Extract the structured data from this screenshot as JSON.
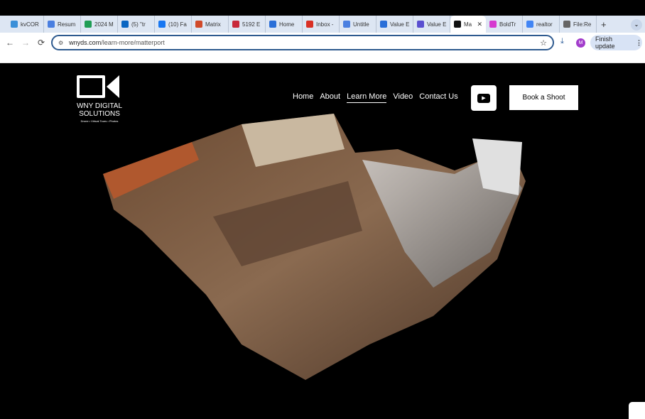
{
  "browser": {
    "tabs": [
      {
        "label": "kvCOR",
        "icon": "kvcore-icon",
        "color": "#3a8fd8"
      },
      {
        "label": "Resum",
        "icon": "docs-icon",
        "color": "#4a7fe0"
      },
      {
        "label": "2024 M",
        "icon": "sheets-icon",
        "color": "#1f9d55"
      },
      {
        "label": "(5) \"tr",
        "icon": "linkedin-icon",
        "color": "#0a66c2"
      },
      {
        "label": "(10) Fa",
        "icon": "facebook-icon",
        "color": "#1877f2"
      },
      {
        "label": "Matrix",
        "icon": "matrix-icon",
        "color": "#d04a2a"
      },
      {
        "label": "5192 E",
        "icon": "robot-icon",
        "color": "#c8283a"
      },
      {
        "label": "Home",
        "icon": "c-icon",
        "color": "#2a6fd8"
      },
      {
        "label": "Inbox -",
        "icon": "gmail-icon",
        "color": "#d93025"
      },
      {
        "label": "Untitle",
        "icon": "docs-icon",
        "color": "#4a7fe0"
      },
      {
        "label": "Value E",
        "icon": "c-icon",
        "color": "#2a6fd8"
      },
      {
        "label": "Value E",
        "icon": "globe-icon",
        "color": "#5a4fd0"
      },
      {
        "label": "Ma",
        "icon": "matterport-icon",
        "color": "#111111",
        "active": true
      },
      {
        "label": "BoldTr",
        "icon": "boldtrail-icon",
        "color": "#d63ad0"
      },
      {
        "label": "realtor",
        "icon": "google-icon",
        "color": "#4285f4"
      },
      {
        "label": "File:Re",
        "icon": "wikipedia-icon",
        "color": "#666666"
      }
    ],
    "url_domain": "wnyds.com",
    "url_path": "/learn-more/matterport",
    "avatar_letter": "M",
    "finish_update": "Finish update"
  },
  "site": {
    "logo_line1": "WNY DIGITAL",
    "logo_line2": "SOLUTIONS",
    "tagline": "Drone • Virtual Tours • Photos",
    "nav": [
      "Home",
      "About",
      "Learn More",
      "Video",
      "Contact Us"
    ],
    "active_nav": "Learn More",
    "book_button": "Book a Shoot"
  }
}
